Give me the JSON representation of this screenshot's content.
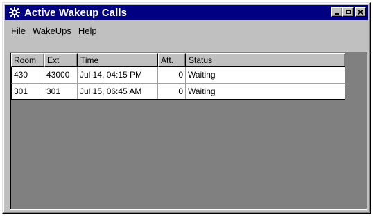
{
  "window": {
    "title": "Active Wakeup Calls",
    "icon": "hotel-app-icon",
    "buttons": [
      "minimize-icon",
      "maximize-icon",
      "close-icon"
    ]
  },
  "menu": [
    {
      "label_u": "F",
      "label_rest": "ile"
    },
    {
      "label_u": "W",
      "label_rest": "akeUps"
    },
    {
      "label_u": "H",
      "label_rest": "elp"
    }
  ],
  "table": {
    "columns": [
      "Room",
      "Ext",
      "Time",
      "Att.",
      "Status"
    ],
    "rows": [
      {
        "room": "430",
        "ext": "43000",
        "time": "Jul 14, 04:15 PM",
        "att": "0",
        "status": "Waiting"
      },
      {
        "room": "301",
        "ext": "301",
        "time": "Jul 15, 06:45 AM",
        "att": "0",
        "status": "Waiting"
      }
    ]
  },
  "colors": {
    "titlebar": "#000080",
    "face": "#c0c0c0",
    "client_background": "#808080"
  }
}
